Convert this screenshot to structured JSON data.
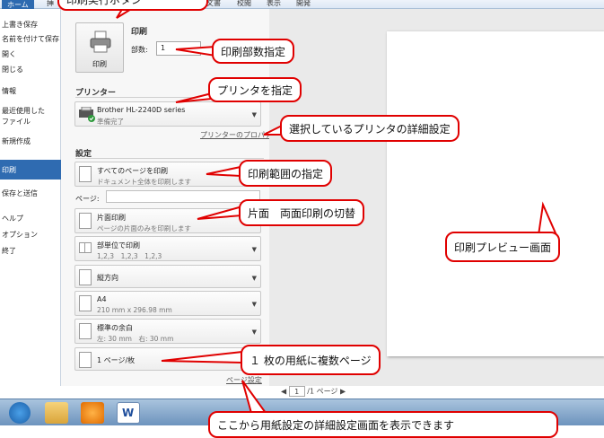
{
  "ribbon": {
    "tabs": [
      "ホーム",
      "挿",
      "文書",
      "校閲",
      "表示",
      "開発"
    ]
  },
  "sidebar": {
    "items": [
      "上書き保存",
      "名前を付けて保存",
      "開く",
      "閉じる",
      "情報",
      "最近使用した",
      "ファイル",
      "新規作成",
      "印刷",
      "保存と送信",
      "ヘルプ",
      "オプション",
      "終了"
    ]
  },
  "print": {
    "section_title": "印刷",
    "button_label": "印刷",
    "copies_label": "部数:",
    "copies_value": "1"
  },
  "printer": {
    "section_title": "プリンター",
    "name": "Brother HL-2240D series",
    "status": "準備完了",
    "properties_link": "プリンターのプロパティ"
  },
  "settings": {
    "section_title": "設定",
    "range": {
      "title": "すべてのページを印刷",
      "subtitle": "ドキュメント全体を印刷します"
    },
    "pages_label": "ページ:",
    "sides": {
      "title": "片面印刷",
      "subtitle": "ページの片面のみを印刷します"
    },
    "collate": {
      "title": "部単位で印刷",
      "subtitle": "1,2,3　1,2,3　1,2,3"
    },
    "orientation": {
      "title": "縦方向"
    },
    "paper": {
      "title": "A4",
      "subtitle": "210 mm x 296.98 mm"
    },
    "margins": {
      "title": "標準の余白",
      "subtitle": "左:  30 mm　右:  30 mm"
    },
    "per_sheet": {
      "title": "1 ページ/枚"
    },
    "page_setup_link": "ページ設定"
  },
  "preview": {
    "page_current": "1",
    "page_total": "/1 ページ"
  },
  "callouts": {
    "c_top": "印刷実行ボタン",
    "c_copies": "印刷部数指定",
    "c_printer": "プリンタを指定",
    "c_props": "選択しているプリンタの詳細設定",
    "c_range": "印刷範囲の指定",
    "c_sides": "片面　両面印刷の切替",
    "c_preview": "印刷プレビュー画面",
    "c_persheet": "１ 枚の用紙に複数ページ",
    "c_setup": "ここから用紙設定の詳細設定画面を表示できます"
  },
  "colors": {
    "callout_border": "#e00000",
    "accent": "#2f6bb1"
  }
}
